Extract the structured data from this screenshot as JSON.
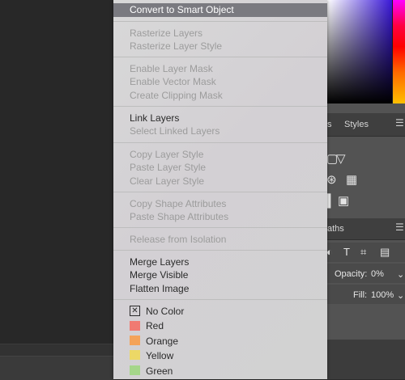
{
  "menu": {
    "highlighted": "Convert to Smart Object",
    "groups": [
      [
        "Rasterize Layers",
        "Rasterize Layer Style"
      ],
      [
        "Enable Layer Mask",
        "Enable Vector Mask",
        "Create Clipping Mask"
      ],
      [
        "Link Layers",
        "Select Linked Layers"
      ],
      [
        "Copy Layer Style",
        "Paste Layer Style",
        "Clear Layer Style"
      ],
      [
        "Copy Shape Attributes",
        "Paste Shape Attributes"
      ],
      [
        "Release from Isolation"
      ],
      [
        "Merge Layers",
        "Merge Visible",
        "Flatten Image"
      ]
    ],
    "enabled": {
      "link_layers": "Link Layers",
      "merge_layers": "Merge Layers",
      "merge_visible": "Merge Visible",
      "flatten_image": "Flatten Image"
    },
    "colors": [
      {
        "label": "No Color",
        "hex": ""
      },
      {
        "label": "Red",
        "hex": "#f07a72"
      },
      {
        "label": "Orange",
        "hex": "#f4a35a"
      },
      {
        "label": "Yellow",
        "hex": "#ecd866"
      },
      {
        "label": "Green",
        "hex": "#a5d68a"
      }
    ]
  },
  "right_panel": {
    "tab_partial": "s",
    "tab_styles": "Styles",
    "tab2_partial": "aths",
    "opacity_label": "Opacity:",
    "opacity_value": "0%",
    "fill_label": "Fill:",
    "fill_value": "100%"
  }
}
